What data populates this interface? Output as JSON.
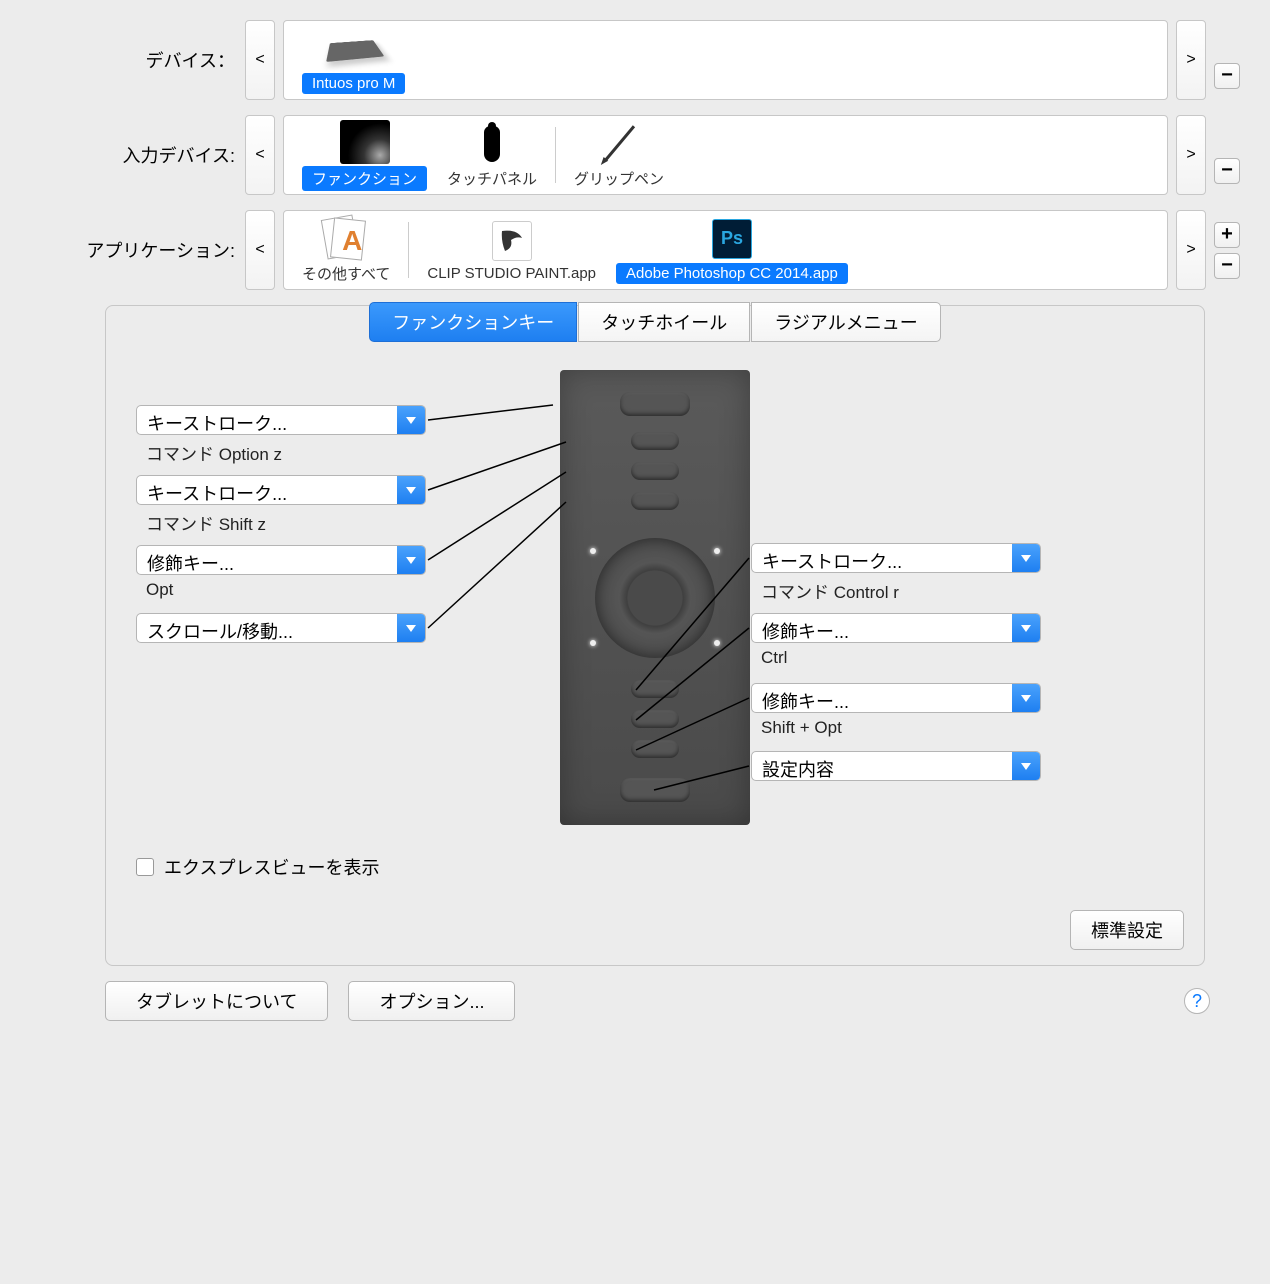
{
  "rows": {
    "device_label": "デバイス：",
    "input_label": "入力デバイス:",
    "app_label": "アプリケーション:"
  },
  "device": {
    "name": "Intuos pro M"
  },
  "inputs": [
    {
      "label": "ファンクション",
      "selected": true
    },
    {
      "label": "タッチパネル",
      "selected": false
    },
    {
      "label": "グリップペン",
      "selected": false
    }
  ],
  "apps": [
    {
      "label": "その他すべて",
      "selected": false
    },
    {
      "label": "CLIP STUDIO PAINT.app",
      "selected": false
    },
    {
      "label": "Adobe Photoshop CC 2014.app",
      "selected": true
    }
  ],
  "tabs": [
    {
      "label": "ファンクションキー",
      "active": true
    },
    {
      "label": "タッチホイール",
      "active": false
    },
    {
      "label": "ラジアルメニュー",
      "active": false
    }
  ],
  "left": [
    {
      "combo": "キーストローク...",
      "sub": "コマンド Option z"
    },
    {
      "combo": "キーストローク...",
      "sub": "コマンド Shift z"
    },
    {
      "combo": "修飾キー...",
      "sub": "Opt"
    },
    {
      "combo": "スクロール/移動...",
      "sub": ""
    }
  ],
  "right": [
    {
      "combo": "キーストローク...",
      "sub": "コマンド Control r"
    },
    {
      "combo": "修飾キー...",
      "sub": "Ctrl"
    },
    {
      "combo": "修飾キー...",
      "sub": "Shift + Opt"
    },
    {
      "combo": "設定内容",
      "sub": ""
    }
  ],
  "express_view": "エクスプレスビューを表示",
  "default_btn": "標準設定",
  "about_btn": "タブレットについて",
  "options_btn": "オプション...",
  "nav": {
    "prev": "<",
    "next": ">"
  },
  "plus": "+",
  "minus": "−",
  "help": "?",
  "csp_glyph": "◢",
  "ps_glyph": "Ps"
}
